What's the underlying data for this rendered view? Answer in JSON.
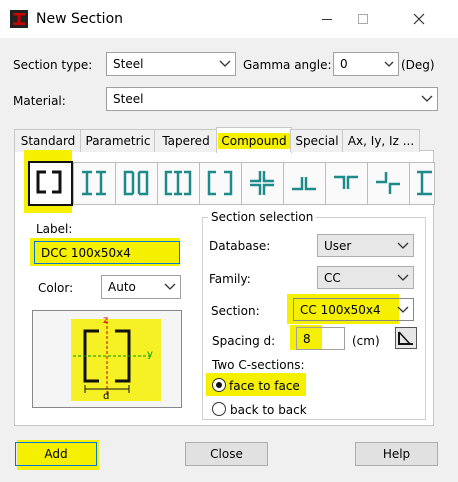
{
  "window": {
    "title": "New Section"
  },
  "top": {
    "section_type_label": "Section type:",
    "section_type_value": "Steel",
    "gamma_label": "Gamma angle:",
    "gamma_value": "0",
    "gamma_unit": "(Deg)",
    "material_label": "Material:",
    "material_value": "Steel"
  },
  "tabs": [
    {
      "label": "Standard"
    },
    {
      "label": "Parametric"
    },
    {
      "label": "Tapered"
    },
    {
      "label": "Compound"
    },
    {
      "label": "Special"
    },
    {
      "label": "Ax, Iy, Iz ..."
    }
  ],
  "left": {
    "label_caption": "Label:",
    "label_value": "DCC 100x50x4",
    "color_caption": "Color:",
    "color_value": "Auto",
    "preview_z": "z",
    "preview_y": "y",
    "preview_d": "d"
  },
  "selection": {
    "group_title": "Section selection",
    "database_label": "Database:",
    "database_value": "User",
    "family_label": "Family:",
    "family_value": "CC",
    "section_label": "Section:",
    "section_value": "CC 100x50x4",
    "spacing_label": "Spacing  d:",
    "spacing_value": "8",
    "spacing_unit": "(cm)",
    "two_c_label": "Two C-sections:",
    "option_face": "face to face",
    "option_back": "back to back"
  },
  "buttons": {
    "add": "Add",
    "close": "Close",
    "help": "Help"
  },
  "colors": {
    "highlight": "#f4f000",
    "accent": "#0078d7",
    "icon_teal": "#1f8a8a"
  }
}
